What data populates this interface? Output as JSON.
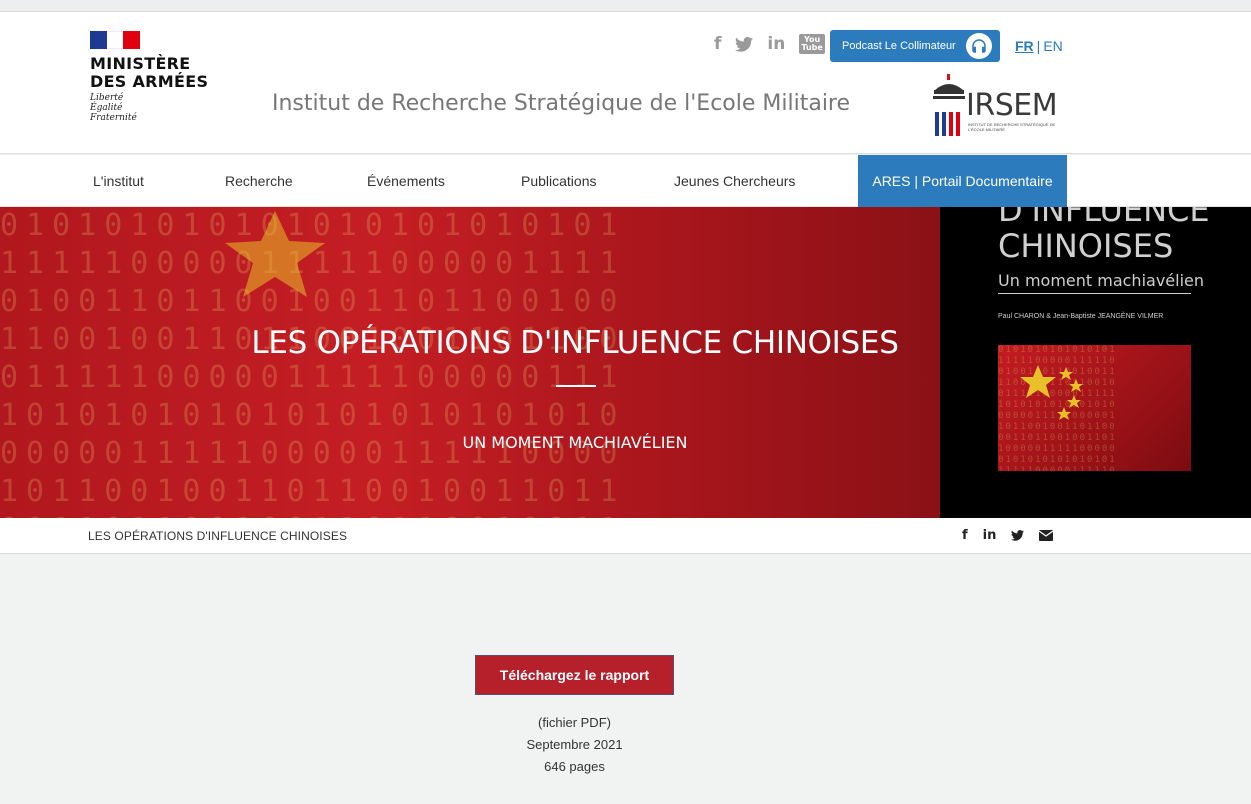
{
  "header": {
    "ministry": {
      "line1": "MINISTÈRE",
      "line2": "DES ARMÉES",
      "motto": [
        "Liberté",
        "Égalité",
        "Fraternité"
      ]
    },
    "site_title": "Institut de Recherche Stratégique de l'Ecole Militaire",
    "social": {
      "facebook": "f",
      "linkedin": "in",
      "youtube_line1": "You",
      "youtube_line2": "Tube"
    },
    "podcast_label": "Podcast Le Collimateur",
    "lang": {
      "fr": "FR",
      "sep": "|",
      "en": "EN"
    },
    "irsem": {
      "word": "IRSEM",
      "sub": "INSTITUT DE RECHERCHE STRATÉGIQUE DE L'ÉCOLE MILITAIRE"
    }
  },
  "nav": {
    "items": [
      {
        "label": "L'institut"
      },
      {
        "label": "Recherche"
      },
      {
        "label": "Événements"
      },
      {
        "label": "Publications"
      },
      {
        "label": "Jeunes Chercheurs"
      },
      {
        "label": "ARES | Portail Documentaire"
      }
    ]
  },
  "hero": {
    "title": "LES OPÉRATIONS D'INFLUENCE CHINOISES",
    "subtitle": "UN MOMENT MACHIAVÉLIEN",
    "cover": {
      "line1": "D'INFLUENCE",
      "line2": "CHINOISES",
      "line3": "Un moment machiavélien",
      "authors": "Paul CHARON & Jean-Baptiste JEANGÈNE VILMER"
    }
  },
  "breadcrumb": {
    "current": "LES OPÉRATIONS D'INFLUENCE CHINOISES"
  },
  "share": {
    "facebook": "f",
    "linkedin": "in"
  },
  "download": {
    "button_label": "Téléchargez le rapport",
    "format": "(fichier PDF)",
    "date": "Septembre 2021",
    "pages": "646 pages"
  },
  "colors": {
    "accent_blue": "#2b7bbd",
    "download_red": "#b5202b",
    "hero_red": "#c41e24"
  }
}
